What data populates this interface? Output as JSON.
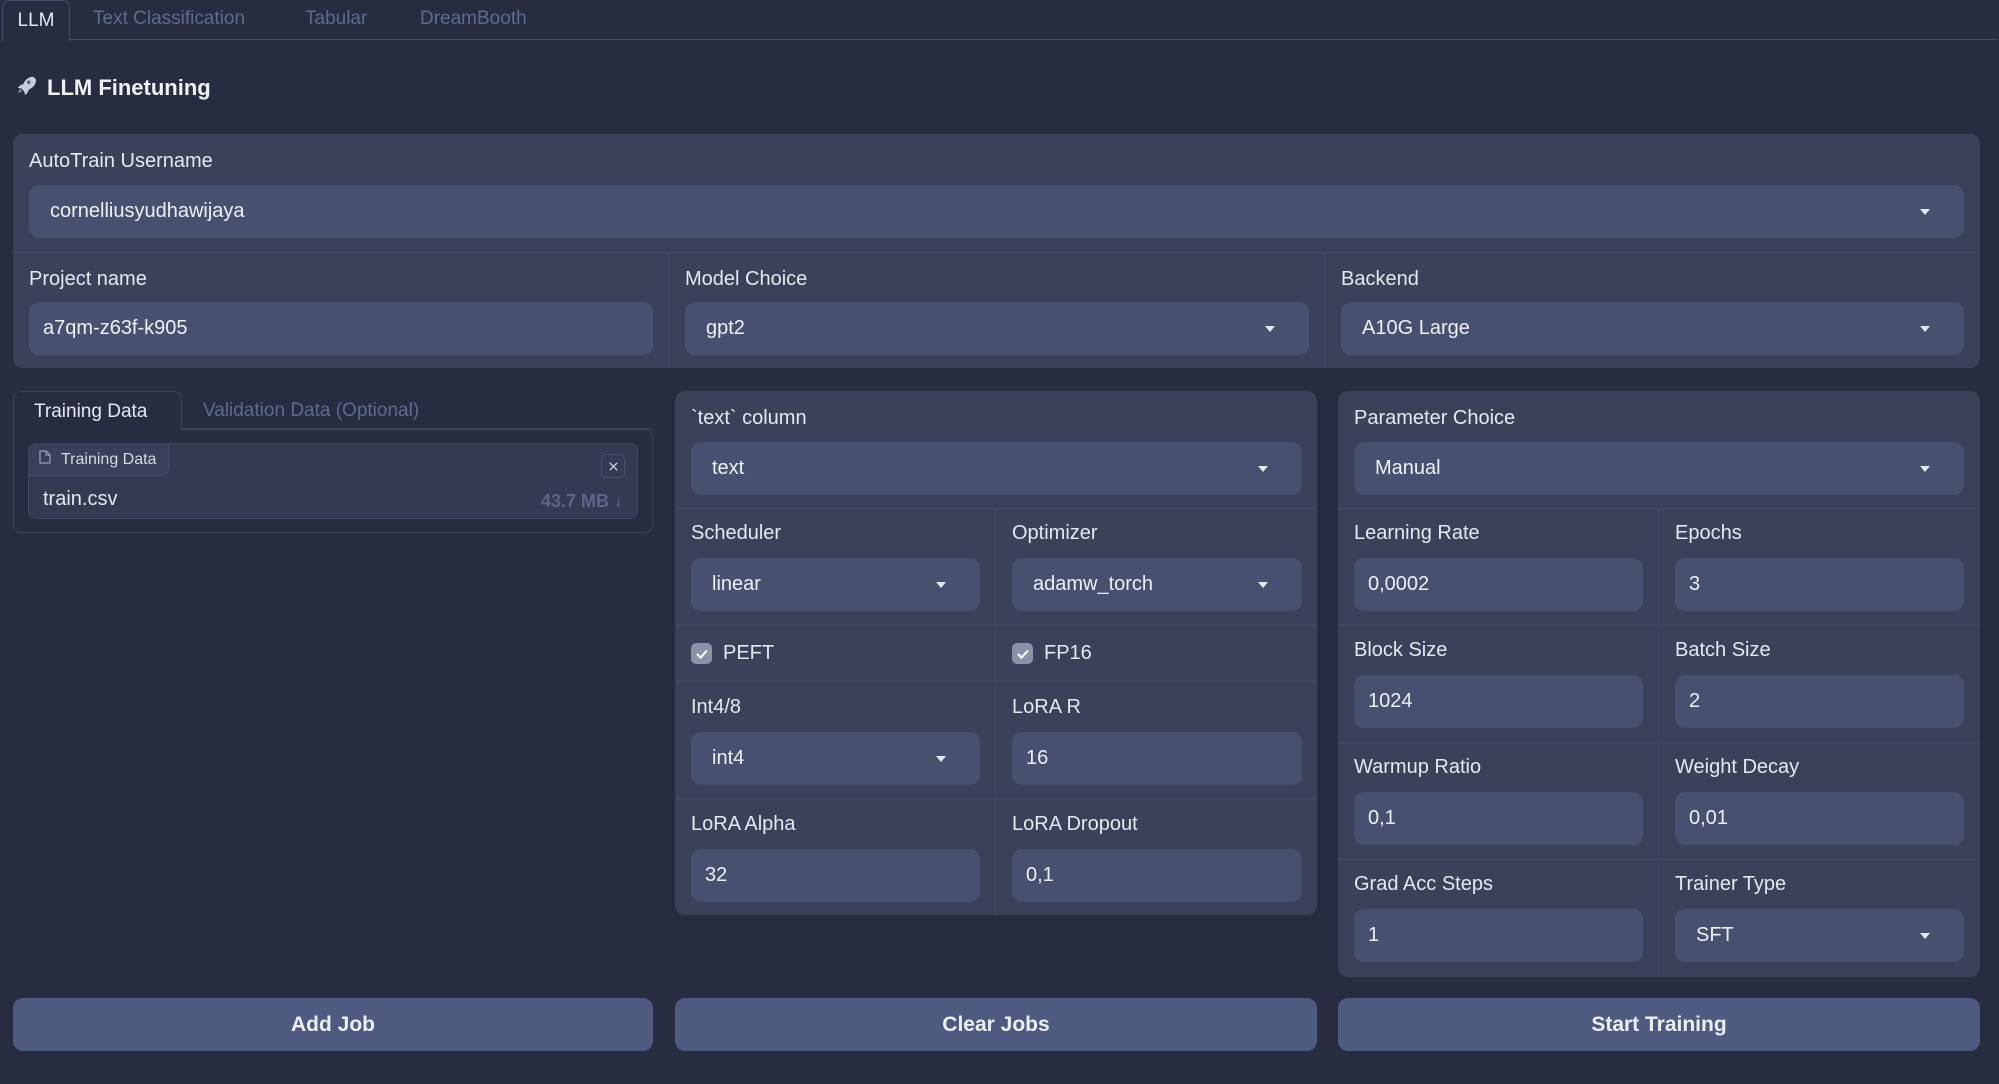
{
  "tabs": [
    {
      "label": "LLM",
      "active": true
    },
    {
      "label": "Text Classification",
      "active": false
    },
    {
      "label": "Tabular",
      "active": false
    },
    {
      "label": "DreamBooth",
      "active": false
    }
  ],
  "page_title": "LLM Finetuning",
  "title_icon": "rocket-icon",
  "top": {
    "username": {
      "label": "AutoTrain Username",
      "value": "cornelliusyudhawijaya"
    },
    "project_name": {
      "label": "Project name",
      "value": "a7qm-z63f-k905"
    },
    "model_choice": {
      "label": "Model Choice",
      "value": "gpt2"
    },
    "backend": {
      "label": "Backend",
      "value": "A10G Large"
    }
  },
  "data_tabs": [
    {
      "label": "Training Data",
      "active": true
    },
    {
      "label": "Validation Data (Optional)",
      "active": false
    }
  ],
  "upload": {
    "label": "Training Data",
    "file_name": "train.csv",
    "file_size": "43.7 MB",
    "download_glyph": "↓",
    "close_glyph": "×"
  },
  "middle": {
    "text_column": {
      "label": "`text` column",
      "value": "text"
    },
    "scheduler": {
      "label": "Scheduler",
      "value": "linear"
    },
    "optimizer": {
      "label": "Optimizer",
      "value": "adamw_torch"
    },
    "peft": {
      "label": "PEFT",
      "checked": true
    },
    "fp16": {
      "label": "FP16",
      "checked": true
    },
    "int48": {
      "label": "Int4/8",
      "value": "int4"
    },
    "lora_r": {
      "label": "LoRA R",
      "value": "16"
    },
    "lora_alpha": {
      "label": "LoRA Alpha",
      "value": "32"
    },
    "lora_dropout": {
      "label": "LoRA Dropout",
      "value": "0,1"
    }
  },
  "right": {
    "parameter_choice": {
      "label": "Parameter Choice",
      "value": "Manual"
    },
    "learning_rate": {
      "label": "Learning Rate",
      "value": "0,0002"
    },
    "epochs": {
      "label": "Epochs",
      "value": "3"
    },
    "block_size": {
      "label": "Block Size",
      "value": "1024"
    },
    "batch_size": {
      "label": "Batch Size",
      "value": "2"
    },
    "warmup_ratio": {
      "label": "Warmup Ratio",
      "value": "0,1"
    },
    "weight_decay": {
      "label": "Weight Decay",
      "value": "0,01"
    },
    "grad_acc_steps": {
      "label": "Grad Acc Steps",
      "value": "1"
    },
    "trainer_type": {
      "label": "Trainer Type",
      "value": "SFT"
    }
  },
  "buttons": {
    "add_job": "Add Job",
    "clear_jobs": "Clear Jobs",
    "start_training": "Start Training"
  },
  "colors": {
    "background": "#272c40",
    "panel": "#3b4159",
    "input": "#47506f",
    "button": "#4f5a80",
    "muted_text": "#5f6a8f"
  }
}
